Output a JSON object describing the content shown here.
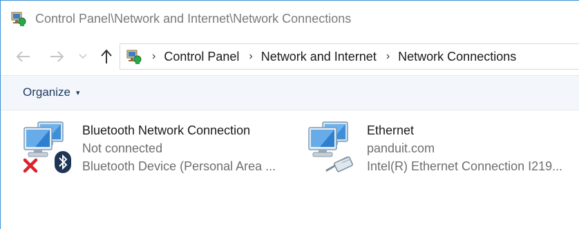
{
  "window": {
    "title": "Control Panel\\Network and Internet\\Network Connections"
  },
  "nav": {
    "back_icon": "arrow-left-icon",
    "forward_icon": "arrow-right-icon",
    "recent_icon": "chevron-down-icon",
    "up_icon": "arrow-up-icon",
    "breadcrumb": [
      {
        "label": "Control Panel"
      },
      {
        "label": "Network and Internet"
      },
      {
        "label": "Network Connections"
      }
    ],
    "separator": "›"
  },
  "toolbar": {
    "organize_label": "Organize",
    "organize_caret": "▾"
  },
  "connections": [
    {
      "name": "Bluetooth Network Connection",
      "status": "Not connected",
      "device": "Bluetooth Device (Personal Area ...",
      "icon": "bluetooth-network-icon",
      "badges": [
        "red-x-icon",
        "bluetooth-icon"
      ]
    },
    {
      "name": "Ethernet",
      "status": "panduit.com",
      "device": "Intel(R) Ethernet Connection I219...",
      "icon": "ethernet-network-icon",
      "badges": [
        "ethernet-cable-icon"
      ]
    }
  ],
  "colors": {
    "window_border": "#3c8fd6",
    "command_bar_bg": "#f3f6fa",
    "error_red": "#d9232d",
    "bluetooth_navy": "#1f3556"
  }
}
